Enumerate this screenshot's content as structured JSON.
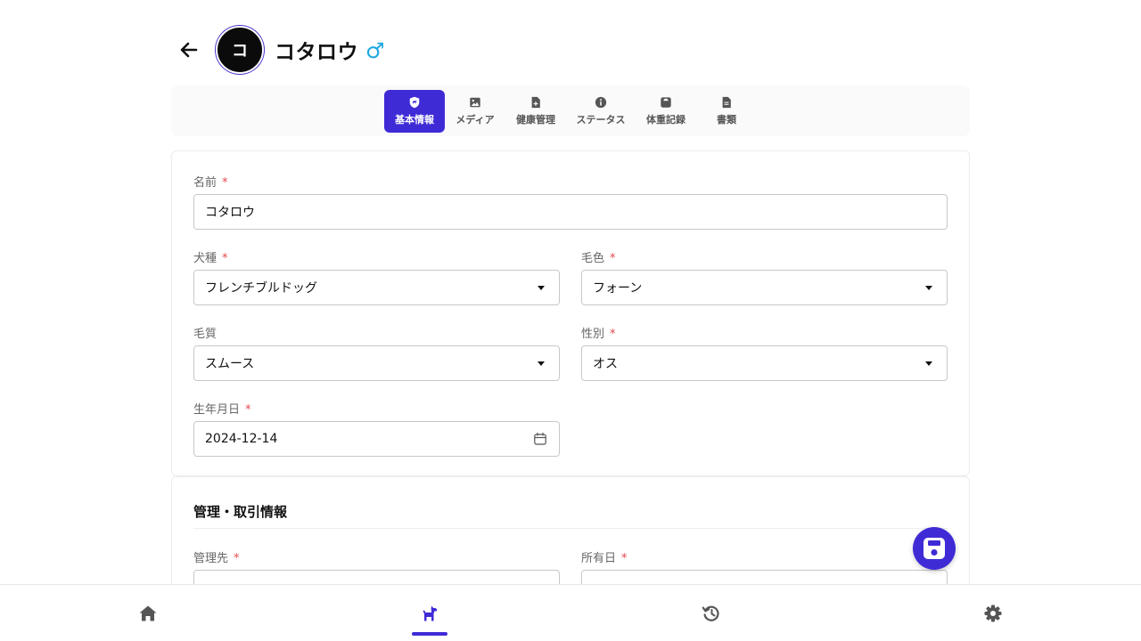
{
  "header": {
    "avatar_initial": "コ",
    "dog_name": "コタロウ",
    "sex_symbol": "♂"
  },
  "tabs": [
    {
      "label": "基本情報",
      "icon": "shield-dog-icon",
      "active": true
    },
    {
      "label": "メディア",
      "icon": "image-icon",
      "active": false
    },
    {
      "label": "健康管理",
      "icon": "file-medical-icon",
      "active": false
    },
    {
      "label": "ステータス",
      "icon": "info-circle-icon",
      "active": false
    },
    {
      "label": "体重記録",
      "icon": "weight-scale-icon",
      "active": false
    },
    {
      "label": "書類",
      "icon": "document-icon",
      "active": false
    }
  ],
  "basic": {
    "name": {
      "label": "名前",
      "value": "コタロウ",
      "required": "*"
    },
    "breed": {
      "label": "犬種",
      "value": "フレンチブルドッグ",
      "required": "*"
    },
    "coat_color": {
      "label": "毛色",
      "value": "フォーン",
      "required": "*"
    },
    "coat_type": {
      "label": "毛質",
      "value": "スムース"
    },
    "sex": {
      "label": "性別",
      "value": "オス",
      "required": "*"
    },
    "birthdate": {
      "label": "生年月日",
      "value": "2024-12-14",
      "required": "*"
    }
  },
  "management": {
    "title": "管理・取引情報",
    "manager": {
      "label": "管理先",
      "required": "*"
    },
    "owned_date": {
      "label": "所有日",
      "required": "*"
    }
  },
  "bottom_nav": [
    {
      "icon": "home-icon",
      "active": false
    },
    {
      "icon": "dog-icon",
      "active": true
    },
    {
      "icon": "history-icon",
      "active": false
    },
    {
      "icon": "gear-icon",
      "active": false
    }
  ],
  "colors": {
    "accent": "#3f2bd6",
    "male_blue": "#1ea7e0",
    "required_red": "#e5484d"
  }
}
